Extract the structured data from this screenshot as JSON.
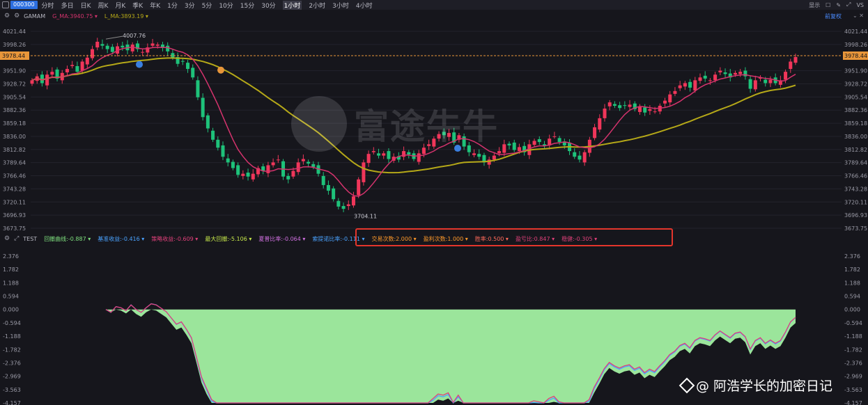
{
  "toolbar": {
    "symbol": "000300",
    "periods": [
      "分时",
      "多日",
      "日K",
      "周K",
      "月K",
      "季K",
      "年K",
      "1分",
      "3分",
      "5分",
      "10分",
      "15分",
      "30分",
      "1小时",
      "2小时",
      "3小时",
      "4小时"
    ],
    "active_period": 13,
    "right": {
      "display": "显示",
      "vs": "VS"
    }
  },
  "main_indicator": {
    "name": "GAMAM",
    "items": [
      {
        "label": "G_MA:3940.75",
        "color": "#d5336d"
      },
      {
        "label": "L_MA:3893.19",
        "color": "#b5a818"
      }
    ],
    "adjust": "前复权"
  },
  "test_indicator": {
    "name": "TEST",
    "items": [
      {
        "label": "回撤曲线:-0.887",
        "color": "#7ee07e"
      },
      {
        "label": "基准收益:-0.416",
        "color": "#4aa3ff"
      },
      {
        "label": "策略收益:-0.609",
        "color": "#e0407a"
      },
      {
        "label": "最大回撤:-5.106",
        "color": "#c6e84a"
      },
      {
        "label": "夏普比率:-0.064",
        "color": "#d070e0"
      },
      {
        "label": "索提诺比率:-0.111",
        "color": "#4aa3ff"
      },
      {
        "label": "交易次数:2.000",
        "color": "#ff9a2a"
      },
      {
        "label": "盈利次数:1.000",
        "color": "#ff9a2a"
      },
      {
        "label": "胜率:0.500",
        "color": "#ff6a5a"
      },
      {
        "label": "盈亏比:0.847",
        "color": "#e0407a"
      },
      {
        "label": "稳健:-0.305",
        "color": "#e0407a"
      }
    ]
  },
  "price_axis": {
    "ticks": [
      4021.44,
      3998.26,
      3951.9,
      3928.72,
      3905.54,
      3882.36,
      3859.18,
      3836.0,
      3812.82,
      3789.64,
      3766.46,
      3743.28,
      3720.11,
      3696.93,
      3673.75
    ],
    "labels": [
      "4021.44",
      "3998.26",
      "3951.90",
      "3928.72",
      "3905.54",
      "3882.36",
      "3859.18",
      "3836.00",
      "3812.82",
      "3789.64",
      "3766.46",
      "3743.28",
      "3720.11",
      "3696.93",
      "3673.75"
    ],
    "current": 3978.44,
    "current_label": "3978.44",
    "high_label": "4007.76",
    "low_label": "3704.11"
  },
  "sub_axis": {
    "ticks": [
      2.376,
      1.782,
      1.188,
      0.594,
      0.0,
      -0.594,
      -1.188,
      -1.782,
      -2.376,
      -2.969,
      -3.563,
      -4.157
    ],
    "labels": [
      "2.376",
      "1.782",
      "1.188",
      "0.594",
      "0.000",
      "-0.594",
      "-1.188",
      "-1.782",
      "-2.376",
      "-2.969",
      "-3.563",
      "-4.157"
    ]
  },
  "watermark": "富途牛牛",
  "credit": "@ 阿浩学长的加密日记",
  "colors": {
    "up": "#f0365a",
    "down": "#1ec27a",
    "gma": "#d5336d",
    "lma": "#b5a818",
    "buy": "#3a7fe0",
    "sell": "#e8963a",
    "drawdown": "#9be59b"
  }
}
